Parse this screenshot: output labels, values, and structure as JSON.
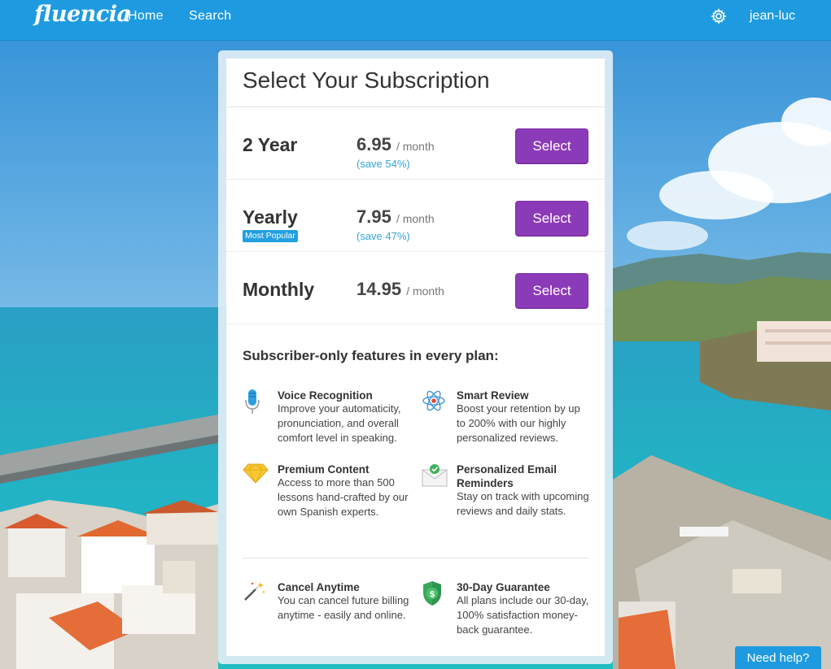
{
  "nav": {
    "logo": "fluencia",
    "links": [
      "Home",
      "Search"
    ],
    "user": "jean-luc",
    "settings_icon": "gear-icon"
  },
  "card": {
    "title": "Select Your Subscription",
    "plans": [
      {
        "name": "2 Year",
        "price": "6.95",
        "per": "/ month",
        "save": "(save 54%)",
        "button": "Select"
      },
      {
        "name": "Yearly",
        "badge": "Most Popular",
        "price": "7.95",
        "per": "/ month",
        "save": "(save 47%)",
        "button": "Select"
      },
      {
        "name": "Monthly",
        "price": "14.95",
        "per": "/ month",
        "button": "Select"
      }
    ],
    "features_heading": "Subscriber-only features in every plan:",
    "features": [
      {
        "icon": "microphone-icon",
        "title": "Voice Recognition",
        "desc": "Improve your automaticity, pronunciation, and overall comfort level in speaking."
      },
      {
        "icon": "atom-icon",
        "title": "Smart Review",
        "desc": "Boost your retention by up to 200% with our highly personalized reviews."
      },
      {
        "icon": "diamond-icon",
        "title": "Premium Content",
        "desc": "Access to more than 500 lessons hand-crafted by our own Spanish experts."
      },
      {
        "icon": "envelope-check-icon",
        "title": "Personalized Email Reminders",
        "desc": "Stay on track with upcoming reviews and daily stats."
      },
      {
        "icon": "magic-wand-icon",
        "title": "Cancel Anytime",
        "desc": "You can cancel future billing anytime - easily and online."
      },
      {
        "icon": "shield-dollar-icon",
        "title": "30-Day Guarantee",
        "desc": "All plans include our 30-day, 100% satisfaction money-back guarantee."
      }
    ]
  },
  "help": {
    "label": "Need help?"
  },
  "colors": {
    "nav": "#1e9be0",
    "button": "#8c3bb8",
    "accent": "#35a3da"
  }
}
